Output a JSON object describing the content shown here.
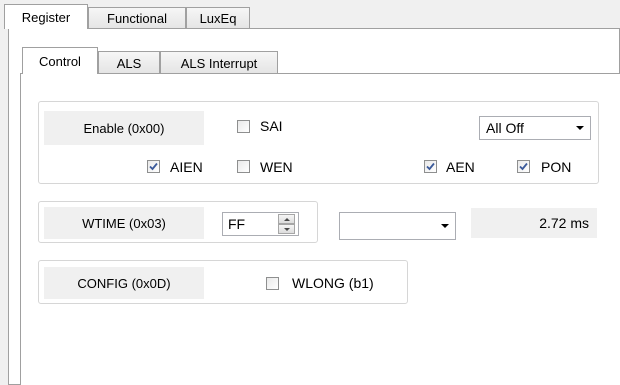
{
  "main_tabs": [
    {
      "label": "Register",
      "active": true
    },
    {
      "label": "Functional",
      "active": false
    },
    {
      "label": "LuxEq",
      "active": false
    }
  ],
  "sub_tabs": [
    {
      "label": "Control",
      "active": true
    },
    {
      "label": "ALS",
      "active": false
    },
    {
      "label": "ALS Interrupt",
      "active": false
    }
  ],
  "enable_group": {
    "register_label": "Enable (0x00)",
    "sai": {
      "label": "SAI",
      "checked": false
    },
    "mode_select": {
      "value": "All Off"
    },
    "aien": {
      "label": "AIEN",
      "checked": true
    },
    "wen": {
      "label": "WEN",
      "checked": false
    },
    "aen": {
      "label": "AEN",
      "checked": true
    },
    "pon": {
      "label": "PON",
      "checked": true
    }
  },
  "wtime_group": {
    "register_label": "WTIME (0x03)",
    "value": "FF",
    "dropdown_value": "",
    "time_readout": "2.72 ms"
  },
  "config_group": {
    "register_label": "CONFIG (0x0D)",
    "wlong": {
      "label": "WLONG (b1)",
      "checked": false
    }
  },
  "icons": {
    "check": "check-icon",
    "dropdown": "chevron-down-icon",
    "spin_up": "spin-up-icon",
    "spin_down": "spin-down-icon"
  },
  "colors": {
    "window_bg": "#f0f0f0",
    "panel_bg": "#ffffff",
    "tab_border": "#a0a0a0",
    "check_color": "#3b5a9a"
  }
}
